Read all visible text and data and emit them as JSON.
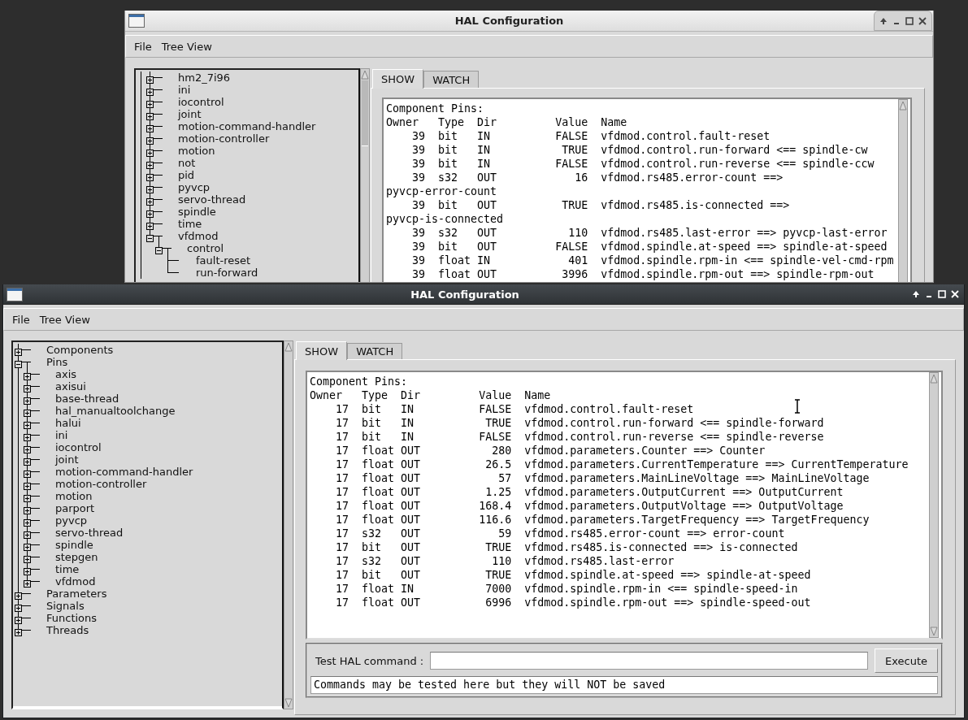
{
  "windows": [
    {
      "title": "HAL Configuration",
      "active": false,
      "menu": [
        "File",
        "Tree View"
      ],
      "tree": [
        {
          "label": "hm2_7i96",
          "expanded": false
        },
        {
          "label": "ini",
          "expanded": false
        },
        {
          "label": "iocontrol",
          "expanded": false
        },
        {
          "label": "joint",
          "expanded": false
        },
        {
          "label": "motion-command-handler",
          "expanded": false
        },
        {
          "label": "motion-controller",
          "expanded": false
        },
        {
          "label": "motion",
          "expanded": false
        },
        {
          "label": "not",
          "expanded": false
        },
        {
          "label": "pid",
          "expanded": false
        },
        {
          "label": "pyvcp",
          "expanded": false
        },
        {
          "label": "servo-thread",
          "expanded": false
        },
        {
          "label": "spindle",
          "expanded": false
        },
        {
          "label": "time",
          "expanded": false
        },
        {
          "label": "vfdmod",
          "expanded": true,
          "children": [
            {
              "label": "control",
              "expanded": true,
              "children": [
                {
                  "label": "fault-reset"
                },
                {
                  "label": "run-forward"
                }
              ]
            }
          ]
        }
      ],
      "tabs": [
        {
          "label": "SHOW",
          "selected": true
        },
        {
          "label": "WATCH",
          "selected": false
        }
      ],
      "text_lines": [
        "Component Pins:",
        "Owner   Type  Dir         Value  Name",
        "    39  bit   IN          FALSE  vfdmod.control.fault-reset",
        "    39  bit   IN           TRUE  vfdmod.control.run-forward <== spindle-cw",
        "    39  bit   IN          FALSE  vfdmod.control.run-reverse <== spindle-ccw",
        "    39  s32   OUT            16  vfdmod.rs485.error-count ==>",
        "pyvcp-error-count",
        "    39  bit   OUT          TRUE  vfdmod.rs485.is-connected ==>",
        "pyvcp-is-connected",
        "    39  s32   OUT           110  vfdmod.rs485.last-error ==> pyvcp-last-error",
        "    39  bit   OUT         FALSE  vfdmod.spindle.at-speed ==> spindle-at-speed",
        "    39  float IN            401  vfdmod.spindle.rpm-in <== spindle-vel-cmd-rpm",
        "    39  float OUT          3996  vfdmod.spindle.rpm-out ==> spindle-rpm-out"
      ]
    },
    {
      "title": "HAL Configuration",
      "active": true,
      "menu": [
        "File",
        "Tree View"
      ],
      "tree": [
        {
          "label": "Components",
          "expanded": false
        },
        {
          "label": "Pins",
          "expanded": true,
          "children": [
            {
              "label": "axis",
              "expanded": false
            },
            {
              "label": "axisui",
              "expanded": false
            },
            {
              "label": "base-thread",
              "expanded": false
            },
            {
              "label": "hal_manualtoolchange",
              "expanded": false
            },
            {
              "label": "halui",
              "expanded": false
            },
            {
              "label": "ini",
              "expanded": false
            },
            {
              "label": "iocontrol",
              "expanded": false
            },
            {
              "label": "joint",
              "expanded": false
            },
            {
              "label": "motion-command-handler",
              "expanded": false
            },
            {
              "label": "motion-controller",
              "expanded": false
            },
            {
              "label": "motion",
              "expanded": false
            },
            {
              "label": "parport",
              "expanded": false
            },
            {
              "label": "pyvcp",
              "expanded": false
            },
            {
              "label": "servo-thread",
              "expanded": false
            },
            {
              "label": "spindle",
              "expanded": false
            },
            {
              "label": "stepgen",
              "expanded": false
            },
            {
              "label": "time",
              "expanded": false
            },
            {
              "label": "vfdmod",
              "expanded": false
            }
          ]
        },
        {
          "label": "Parameters",
          "expanded": false
        },
        {
          "label": "Signals",
          "expanded": false
        },
        {
          "label": "Functions",
          "expanded": false
        },
        {
          "label": "Threads",
          "expanded": false
        }
      ],
      "tabs": [
        {
          "label": "SHOW",
          "selected": true
        },
        {
          "label": "WATCH",
          "selected": false
        }
      ],
      "text_lines": [
        "Component Pins:",
        "Owner   Type  Dir         Value  Name",
        "    17  bit   IN          FALSE  vfdmod.control.fault-reset",
        "    17  bit   IN           TRUE  vfdmod.control.run-forward <== spindle-forward",
        "    17  bit   IN          FALSE  vfdmod.control.run-reverse <== spindle-reverse",
        "    17  float OUT           280  vfdmod.parameters.Counter ==> Counter",
        "    17  float OUT          26.5  vfdmod.parameters.CurrentTemperature ==> CurrentTemperature",
        "    17  float OUT            57  vfdmod.parameters.MainLineVoltage ==> MainLineVoltage",
        "    17  float OUT          1.25  vfdmod.parameters.OutputCurrent ==> OutputCurrent",
        "    17  float OUT         168.4  vfdmod.parameters.OutputVoltage ==> OutputVoltage",
        "    17  float OUT         116.6  vfdmod.parameters.TargetFrequency ==> TargetFrequency",
        "    17  s32   OUT            59  vfdmod.rs485.error-count ==> error-count",
        "    17  bit   OUT          TRUE  vfdmod.rs485.is-connected ==> is-connected",
        "    17  s32   OUT           110  vfdmod.rs485.last-error",
        "    17  bit   OUT          TRUE  vfdmod.spindle.at-speed ==> spindle-at-speed",
        "    17  float IN           7000  vfdmod.spindle.rpm-in <== spindle-speed-in",
        "    17  float OUT          6996  vfdmod.spindle.rpm-out ==> spindle-speed-out"
      ],
      "command": {
        "label": "Test HAL command :",
        "button": "Execute",
        "message": "Commands may be tested here but they will NOT be saved"
      }
    }
  ]
}
